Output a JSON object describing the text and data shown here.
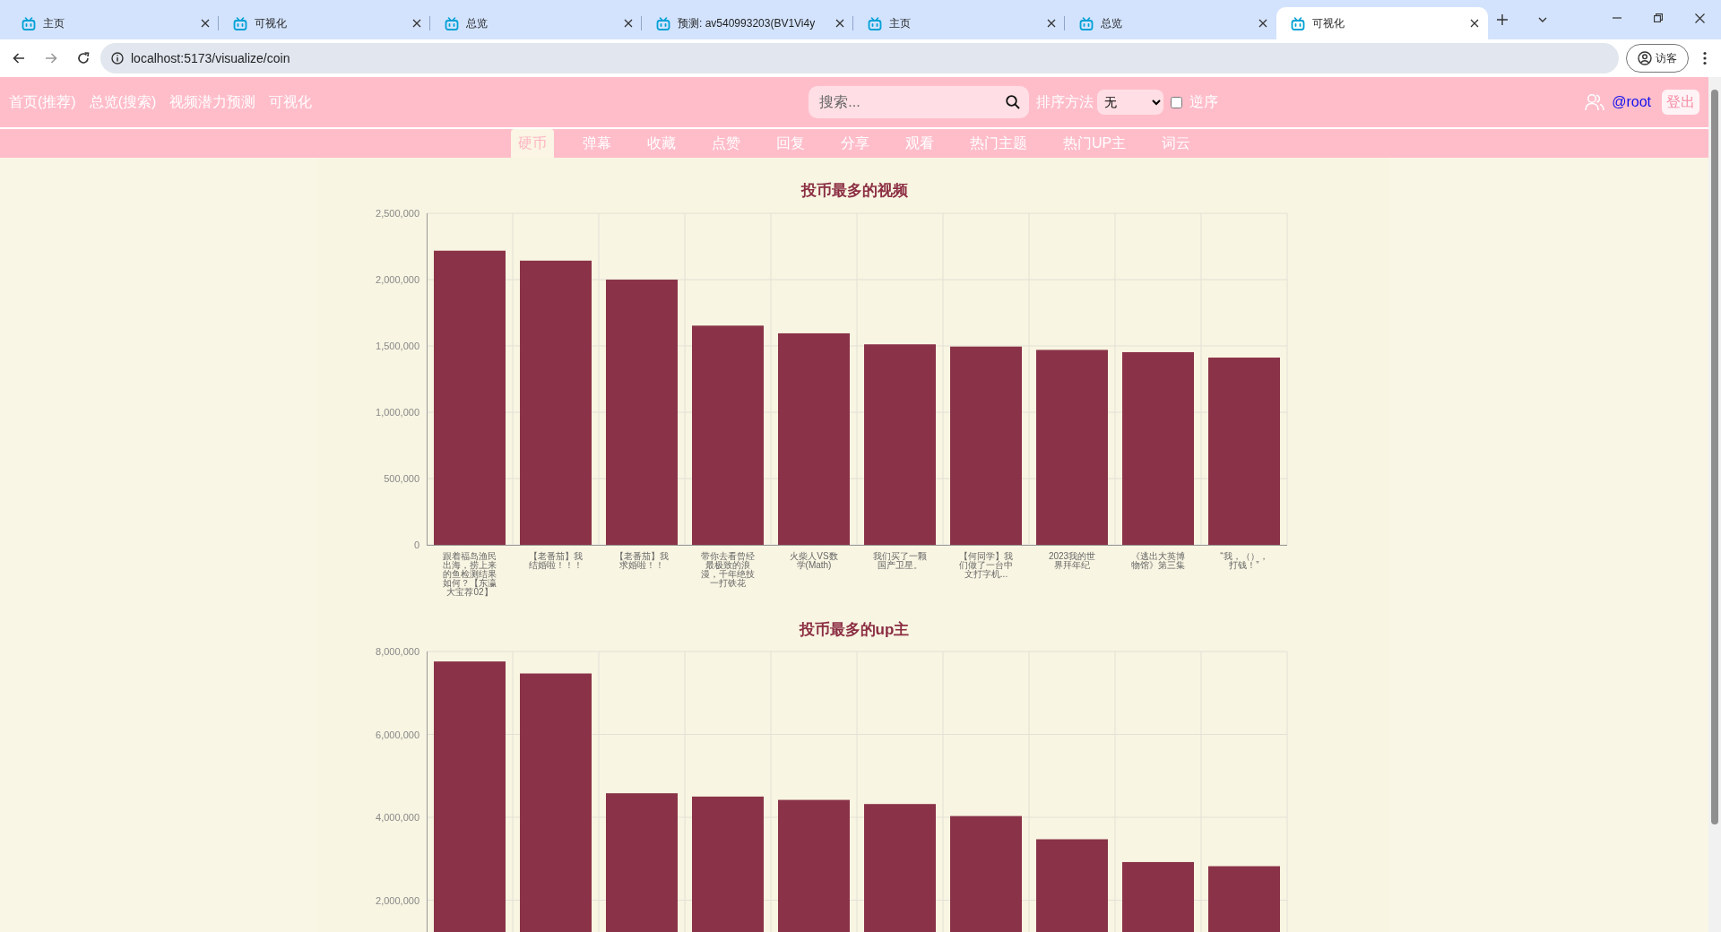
{
  "browser": {
    "tabs": [
      {
        "title": "主页",
        "selected": false
      },
      {
        "title": "可视化",
        "selected": false
      },
      {
        "title": "总览",
        "selected": false
      },
      {
        "title": "预测: av540993203(BV1Vi4y",
        "selected": false
      },
      {
        "title": "主页",
        "selected": false
      },
      {
        "title": "总览",
        "selected": false
      },
      {
        "title": "可视化",
        "selected": true
      }
    ],
    "url": "localhost:5173/visualize/coin",
    "profile": "访客"
  },
  "header": {
    "nav_links": [
      {
        "label": "首页(推荐)"
      },
      {
        "label": "总览(搜索)"
      },
      {
        "label": "视频潜力预测"
      },
      {
        "label": "可视化"
      }
    ],
    "search": {
      "placeholder": "搜索..."
    },
    "sort": {
      "label": "排序方法",
      "value": "无",
      "reverse_label": "逆序",
      "reverse": false
    },
    "user": "@root",
    "logout": "登出"
  },
  "subnav": [
    {
      "label": "硬币",
      "selected": true
    },
    {
      "label": "弹幕",
      "selected": false
    },
    {
      "label": "收藏",
      "selected": false
    },
    {
      "label": "点赞",
      "selected": false
    },
    {
      "label": "回复",
      "selected": false
    },
    {
      "label": "分享",
      "selected": false
    },
    {
      "label": "观看",
      "selected": false
    },
    {
      "label": "热门主题",
      "selected": false
    },
    {
      "label": "热门UP主",
      "selected": false
    },
    {
      "label": "词云",
      "selected": false
    }
  ],
  "charts": [
    {
      "chart_data": {
        "type": "bar",
        "title": "投币最多的视频",
        "grid": true,
        "categories": [
          "跟着福岛渔民出海，捞上来的鱼检测结果如何？【东瀛大宝荐02】",
          "【老番茄】我结婚啦！！！",
          "【老番茄】我求婚啦！！",
          "带你去看曾经最极致的浪漫，千年绝技一打铁花",
          "火柴人VS数学(Math)",
          "我们买了一颗国产卫星。",
          "【何同学】我们做了一台中文打字机...",
          "2023我的世界拜年纪",
          "《逃出大英博物馆》第三集",
          "“我，（），打钱！”"
        ],
        "values": [
          2218000,
          2143000,
          2000000,
          1653000,
          1595000,
          1512000,
          1495000,
          1470000,
          1453000,
          1412000
        ],
        "ylim": [
          0,
          2500000
        ],
        "yticks": [
          {
            "value": 0,
            "label": "0"
          },
          {
            "value": 500000,
            "label": "500,000"
          },
          {
            "value": 1000000,
            "label": "1,000,000"
          },
          {
            "value": 1500000,
            "label": "1,500,000"
          },
          {
            "value": 2000000,
            "label": "2,000,000"
          },
          {
            "value": 2500000,
            "label": "2,500,000"
          }
        ]
      }
    },
    {
      "chart_data": {
        "type": "bar",
        "title": "投币最多的up主",
        "grid": true,
        "values": [
          7760000,
          7470000,
          4580000,
          4500000,
          4420000,
          4320000,
          4030000,
          3470000,
          2920000,
          2820000
        ],
        "ylim": [
          0,
          8000000
        ],
        "yticks": [
          {
            "value": 2000000,
            "label": "2,000,000"
          },
          {
            "value": 4000000,
            "label": "4,000,000"
          },
          {
            "value": 6000000,
            "label": "6,000,000"
          },
          {
            "value": 8000000,
            "label": "8,000,000"
          }
        ]
      }
    }
  ]
}
